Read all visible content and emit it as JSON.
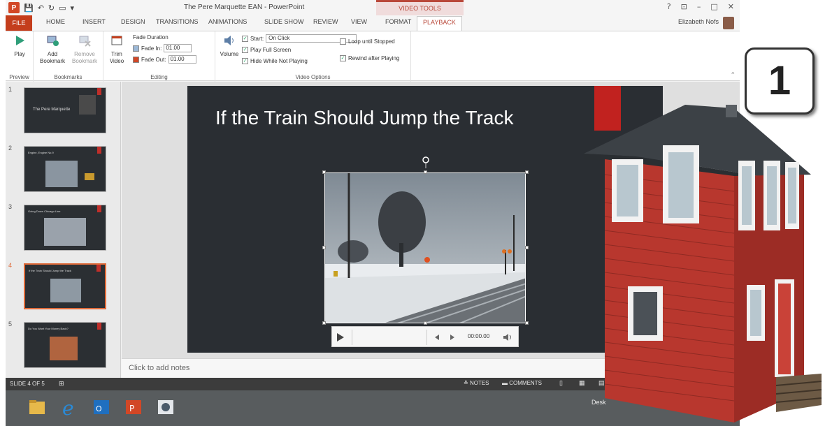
{
  "titlebar": {
    "title": "The Pere Marquette EAN - PowerPoint",
    "video_tools": "VIDEO TOOLS",
    "help": "?",
    "restore": "⊡",
    "minimize": "–",
    "maximize": "□",
    "close": "✕",
    "user": "Elizabeth Nofs"
  },
  "tabs": [
    "FILE",
    "HOME",
    "INSERT",
    "DESIGN",
    "TRANSITIONS",
    "ANIMATIONS",
    "SLIDE SHOW",
    "REVIEW",
    "VIEW",
    "FORMAT",
    "PLAYBACK"
  ],
  "ribbon": {
    "preview": {
      "play": "Play",
      "label": "Preview"
    },
    "bookmarks": {
      "add": "Add Bookmark",
      "remove": "Remove Bookmark",
      "label": "Bookmarks"
    },
    "editing": {
      "trim": "Trim Video",
      "fade_duration": "Fade Duration",
      "fade_in": "Fade In:",
      "fade_in_value": "01.00",
      "fade_out": "Fade Out:",
      "fade_out_value": "01.00",
      "label": "Editing"
    },
    "video_options": {
      "volume": "Volume",
      "start": "Start:",
      "start_value": "On Click",
      "play_full_screen": "Play Full Screen",
      "hide_while_not_playing": "Hide While Not Playing",
      "loop": "Loop until Stopped",
      "rewind": "Rewind after Playing",
      "label": "Video Options"
    }
  },
  "thumbnails": [
    {
      "num": "1",
      "title": "The Pere Marquette"
    },
    {
      "num": "2",
      "title": "Engine, Engine No.9"
    },
    {
      "num": "3",
      "title": "Going Down Chicago Line"
    },
    {
      "num": "4",
      "title": "If the Train Should Jump the Track"
    },
    {
      "num": "5",
      "title": "Do You Want Your Money Back?"
    }
  ],
  "slide": {
    "title": "If the Train Should Jump the Track",
    "player_time": "00:00.00"
  },
  "notes_placeholder": "Click to add notes",
  "statusbar": {
    "slide_indicator": "SLIDE 4 OF 5",
    "notes": "NOTES",
    "comments": "COMMENTS"
  },
  "taskbar": {
    "desktop": "Desk"
  },
  "callout_number": "1",
  "colors": {
    "accent": "#b9483a",
    "file_tab": "#c43e1c",
    "slide_bg": "#2a2e33",
    "slide_red": "#c1221f"
  }
}
